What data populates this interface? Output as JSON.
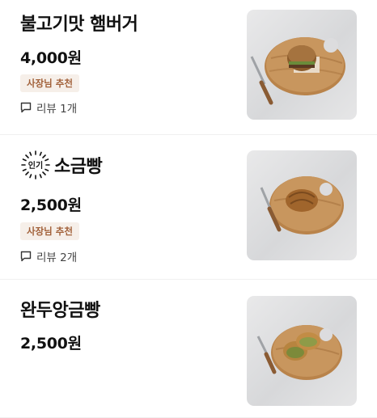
{
  "menu_items": [
    {
      "name": "불고기맛 햄버거",
      "price": "4,000원",
      "badge": "사장님 추천",
      "review": "리뷰 1개",
      "image_icon": "burger-on-board-photo"
    },
    {
      "popular_label": "인기",
      "name": "소금빵",
      "price": "2,500원",
      "badge": "사장님 추천",
      "review": "리뷰 2개",
      "image_icon": "salt-bread-on-board-photo"
    },
    {
      "name": "완두앙금빵",
      "price": "2,500원",
      "image_icon": "pea-bean-bread-on-board-photo"
    }
  ],
  "colors": {
    "badge_bg": "#f6efe9",
    "badge_text": "#a2613a",
    "board_wood": "#b9834a"
  }
}
